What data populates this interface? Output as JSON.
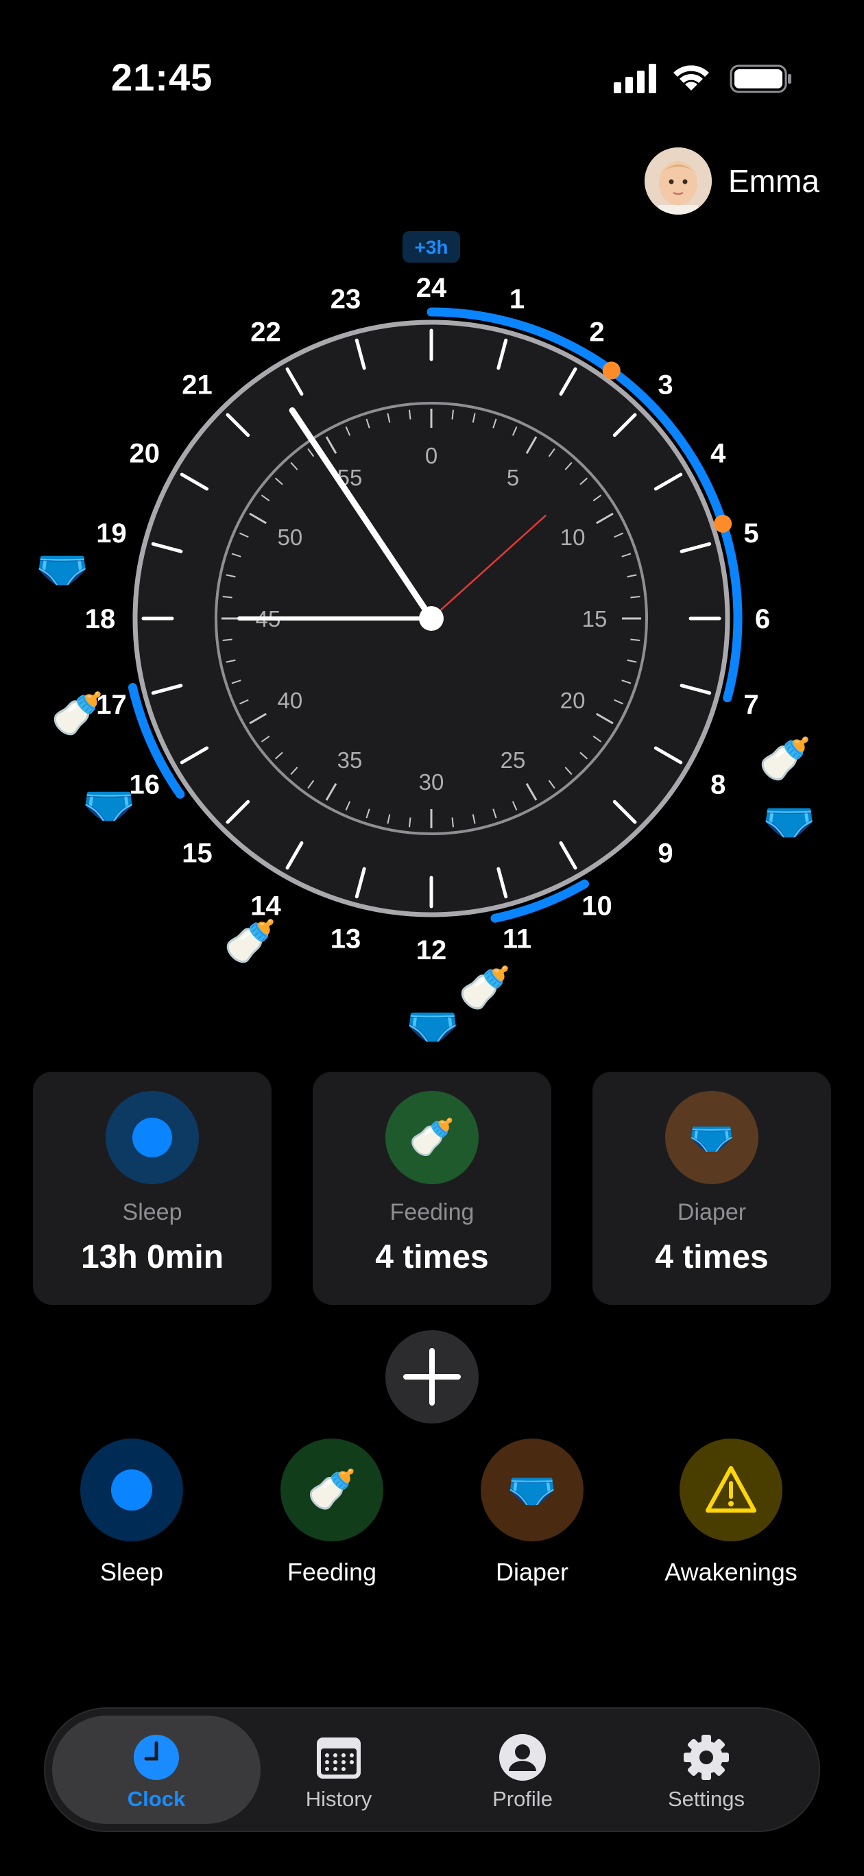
{
  "status": {
    "time": "21:45"
  },
  "profile": {
    "name": "Emma"
  },
  "clock": {
    "offset_badge": "+3h",
    "hour_labels": [
      "24",
      "1",
      "2",
      "3",
      "4",
      "5",
      "6",
      "7",
      "8",
      "9",
      "10",
      "11",
      "12",
      "13",
      "14",
      "15",
      "16",
      "17",
      "18",
      "19",
      "20",
      "21",
      "22",
      "23"
    ],
    "minute_labels": [
      "0",
      "5",
      "10",
      "15",
      "20",
      "25",
      "30",
      "35",
      "40",
      "45",
      "50",
      "55"
    ],
    "hands": {
      "hour_minutes": 1305,
      "minute": 45,
      "second": 8
    }
  },
  "colors": {
    "sleep": "#0a84ff",
    "awake_marker": "#ff8c28",
    "second_hand": "#e53935"
  },
  "icons": {
    "feeding": "baby-bottle-icon",
    "diaper": "diaper-icon"
  },
  "stats": [
    {
      "label": "Sleep",
      "value": "13h 0min",
      "icon": "sleep-dot-icon"
    },
    {
      "label": "Feeding",
      "value": "4 times",
      "icon": "baby-bottle-icon"
    },
    {
      "label": "Diaper",
      "value": "4 times",
      "icon": "diaper-icon"
    }
  ],
  "actions": [
    {
      "label": "Sleep",
      "icon": "sleep-dot-icon"
    },
    {
      "label": "Feeding",
      "icon": "baby-bottle-icon"
    },
    {
      "label": "Diaper",
      "icon": "diaper-icon"
    },
    {
      "label": "Awakenings",
      "icon": "warning-icon"
    }
  ],
  "tabs": [
    {
      "label": "Clock",
      "icon": "clock-icon",
      "active": true
    },
    {
      "label": "History",
      "icon": "calendar-icon",
      "active": false
    },
    {
      "label": "Profile",
      "icon": "person-icon",
      "active": false
    },
    {
      "label": "Settings",
      "icon": "gear-icon",
      "active": false
    }
  ]
}
